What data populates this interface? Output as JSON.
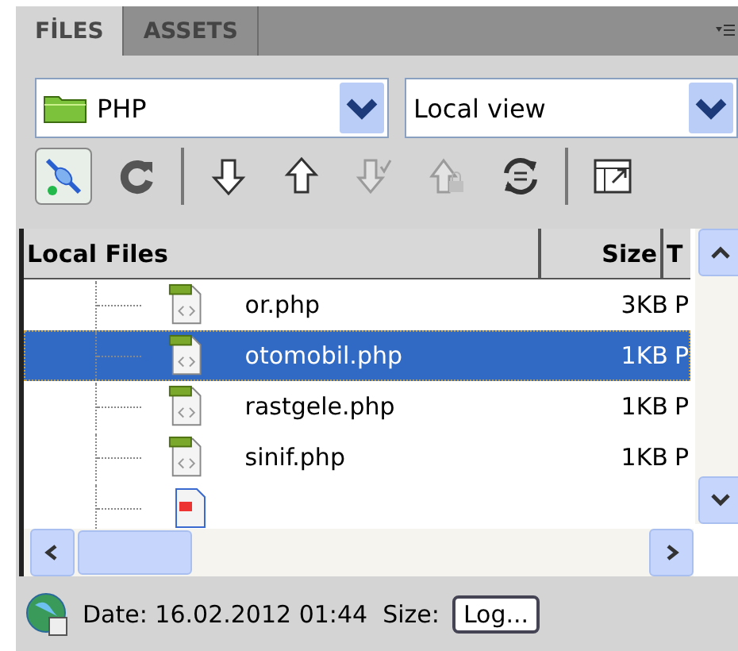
{
  "tabs": [
    {
      "label": "FİLES",
      "selected": true
    },
    {
      "label": "ASSETS",
      "selected": false
    }
  ],
  "site_dropdown": {
    "value": "PHP"
  },
  "view_dropdown": {
    "value": "Local view"
  },
  "toolbar": [
    {
      "kind": "connect",
      "selected": true,
      "disabled": false
    },
    {
      "kind": "refresh",
      "selected": false,
      "disabled": false
    },
    {
      "kind": "separator"
    },
    {
      "kind": "get",
      "selected": false,
      "disabled": false
    },
    {
      "kind": "put",
      "selected": false,
      "disabled": false
    },
    {
      "kind": "checkin",
      "selected": false,
      "disabled": true
    },
    {
      "kind": "checkout",
      "selected": false,
      "disabled": true
    },
    {
      "kind": "sync",
      "selected": false,
      "disabled": false
    },
    {
      "kind": "separator"
    },
    {
      "kind": "expand",
      "selected": false,
      "disabled": false
    }
  ],
  "table": {
    "columns": [
      "Local Files",
      "Size",
      "T"
    ],
    "rows": [
      {
        "kind": "php",
        "name": "or.php",
        "size": "3KB",
        "column_3": "P",
        "selected": false
      },
      {
        "kind": "php",
        "name": "otomobil.php",
        "size": "1KB",
        "column_3": "P",
        "selected": true
      },
      {
        "kind": "php",
        "name": "rastgele.php",
        "size": "1KB",
        "column_3": "P",
        "selected": false
      },
      {
        "kind": "php",
        "name": "sinif.php",
        "size": "1KB",
        "column_3": "P",
        "selected": false
      },
      {
        "kind": "image",
        "selected": false
      }
    ]
  },
  "status_bar": {
    "text": "Date: 16.02.2012 01:44  Size:",
    "button": "Log..."
  }
}
